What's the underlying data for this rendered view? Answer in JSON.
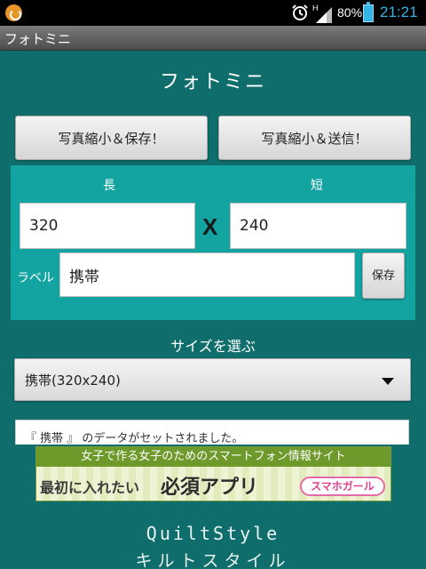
{
  "status_bar": {
    "battery": "80%",
    "time": "21:21",
    "network_label": "H",
    "icons": [
      "notification-icon",
      "alarm-icon",
      "signal-icon",
      "battery-icon"
    ]
  },
  "title_bar": {
    "title": "フォトミニ"
  },
  "header": {
    "title": "フォトミニ"
  },
  "buttons": {
    "save_shrink": "写真縮小＆保存！",
    "send_shrink": "写真縮小＆送信！",
    "store": "保存"
  },
  "size_panel": {
    "long_label": "長",
    "short_label": "短",
    "long_value": "320",
    "short_value": "240",
    "x_mark": "X",
    "label_caption": "ラベル",
    "label_value": "携帯"
  },
  "choose": {
    "heading": "サイズを選ぶ",
    "selected": "携帯(320x240)"
  },
  "message": "『 携帯 』 のデータがセットされました。",
  "ad": {
    "top_text": "女子で作る女子のためのスマートフォン情報サイト",
    "text1": "最初に入れたい",
    "text2": "必須アプリ",
    "badge": "スマホガール"
  },
  "footer": {
    "brand": "QuiltStyle",
    "brand_kana": "キルトスタイル"
  },
  "colors": {
    "background": "#0f6e6b",
    "panel": "#13a3a1",
    "time": "#33b5e5"
  }
}
